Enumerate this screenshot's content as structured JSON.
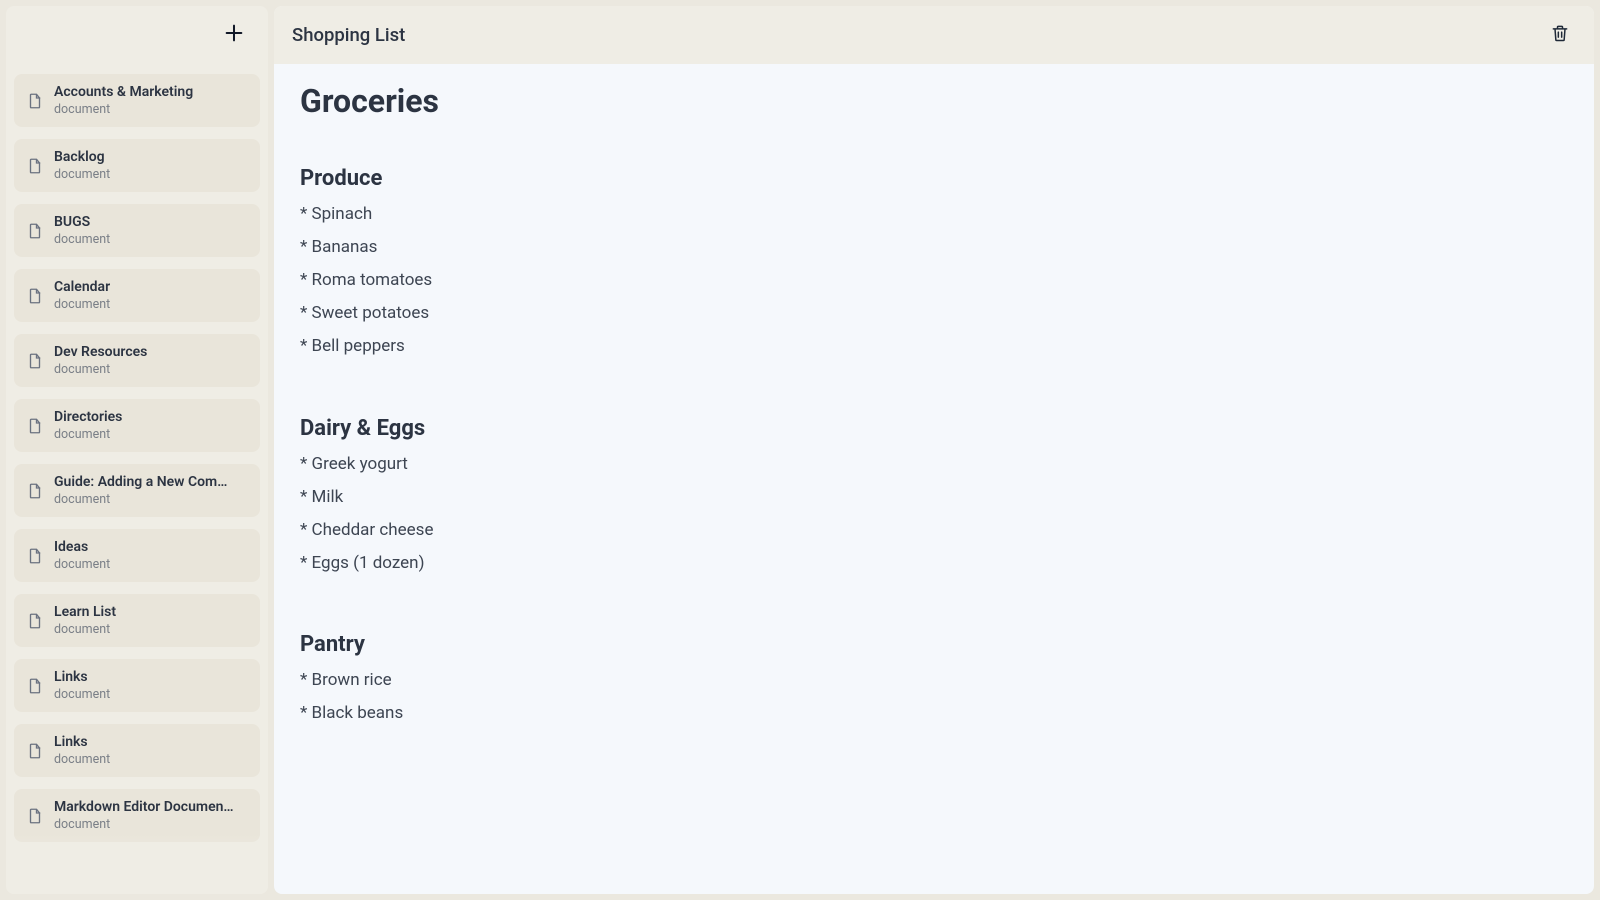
{
  "sidebar": {
    "type_label": "document",
    "items": [
      {
        "title": "Accounts & Marketing"
      },
      {
        "title": "Backlog"
      },
      {
        "title": "BUGS"
      },
      {
        "title": "Calendar"
      },
      {
        "title": "Dev Resources"
      },
      {
        "title": "Directories"
      },
      {
        "title": "Guide: Adding a New Com…"
      },
      {
        "title": "Ideas"
      },
      {
        "title": "Learn List"
      },
      {
        "title": "Links"
      },
      {
        "title": "Links"
      },
      {
        "title": "Markdown Editor Documen…"
      }
    ]
  },
  "header": {
    "title": "Shopping List"
  },
  "document": {
    "h1": "Groceries",
    "sections": [
      {
        "heading": "Produce",
        "items": [
          "Spinach",
          "Bananas",
          "Roma tomatoes",
          "Sweet potatoes",
          "Bell peppers"
        ]
      },
      {
        "heading": "Dairy & Eggs",
        "items": [
          "Greek yogurt",
          "Milk",
          "Cheddar cheese",
          "Eggs (1 dozen)"
        ]
      },
      {
        "heading": "Pantry",
        "items": [
          "Brown rice",
          "Black beans"
        ]
      }
    ]
  }
}
